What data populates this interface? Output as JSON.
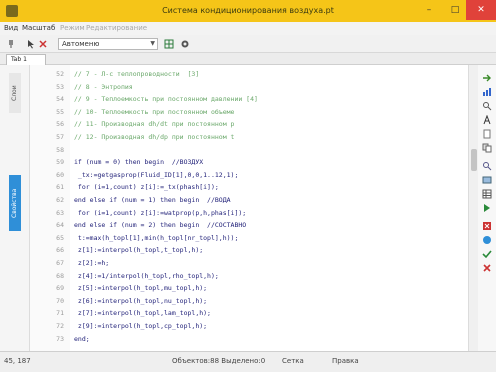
{
  "window": {
    "title": "Система кондиционирования воздуха.pt",
    "minimize_glyph": "–",
    "maximize_glyph": "□",
    "close_glyph": "✕"
  },
  "menu": [
    "Вид",
    "Масштаб",
    "Режим",
    "Редактирование"
  ],
  "toolbar": {
    "combo_value": "Автоменю"
  },
  "tabs": [
    {
      "label": "Tab 1"
    }
  ],
  "left_panel": {
    "tab1": "Слои",
    "tab2": "Свойства"
  },
  "editor": {
    "lines": [
      {
        "n": "52",
        "text": "// 7 - Л-с теплопроводности  [3]",
        "kind": "comment"
      },
      {
        "n": "53",
        "text": "// 8 - Энтропия",
        "kind": "comment"
      },
      {
        "n": "54",
        "text": "// 9 - Теплоемкость при постоянном давлении [4]",
        "kind": "comment"
      },
      {
        "n": "55",
        "text": "// 10- Теплоемкость при постоянном объеме",
        "kind": "comment"
      },
      {
        "n": "56",
        "text": "// 11- Производная dh/dt при постоянном p",
        "kind": "comment"
      },
      {
        "n": "57",
        "text": "// 12- Производная dh/dp при постоянном t",
        "kind": "comment"
      },
      {
        "n": "58",
        "text": "",
        "kind": "code"
      },
      {
        "n": "59",
        "text": "if (num = 0) then begin  //ВОЗДУХ",
        "kind": "code"
      },
      {
        "n": "60",
        "text": " _tx:=getgasprop(Fluid_ID[1],0,0,1..12,1);",
        "kind": "code"
      },
      {
        "n": "61",
        "text": " for (i=1,count) z[i]:=_tx(phash[i]);",
        "kind": "code"
      },
      {
        "n": "62",
        "text": "end else if (num = 1) then begin  //ВОДА",
        "kind": "code"
      },
      {
        "n": "63",
        "text": " for (i=1,count) z[i]:=watprop(p,h,phas[i]);",
        "kind": "code"
      },
      {
        "n": "64",
        "text": "end else if (num = 2) then begin  //СОСТАВНО",
        "kind": "code"
      },
      {
        "n": "65",
        "text": " t:=max(h_topl[1],min(h_topl[nr_topl],h));",
        "kind": "code"
      },
      {
        "n": "66",
        "text": " z[1]:=interpol(h_topl,t_topl,h);",
        "kind": "code"
      },
      {
        "n": "67",
        "text": " z[2]:=h;",
        "kind": "code"
      },
      {
        "n": "68",
        "text": " z[4]:=1/interpol(h_topl,rho_topl,h);",
        "kind": "code"
      },
      {
        "n": "69",
        "text": " z[5]:=interpol(h_topl,mu_topl,h);",
        "kind": "code"
      },
      {
        "n": "70",
        "text": " z[6]:=interpol(h_topl,nu_topl,h);",
        "kind": "code"
      },
      {
        "n": "71",
        "text": " z[7]:=interpol(h_topl,lam_topl,h);",
        "kind": "code"
      },
      {
        "n": "72",
        "text": " z[9]:=interpol(h_topl,cp_topl,h);",
        "kind": "code"
      },
      {
        "n": "73",
        "text": "end;",
        "kind": "code"
      }
    ]
  },
  "status": {
    "position": "45, 187",
    "objects": "Объектов:88  Выделено:0",
    "grid": "Сетка",
    "mode": "Правка"
  },
  "colors": {
    "titlebar": "#f5c518",
    "close": "#e0423a",
    "comment": "#6aa86a",
    "code": "#23237a",
    "accent_tab": "#2f8fd8"
  }
}
